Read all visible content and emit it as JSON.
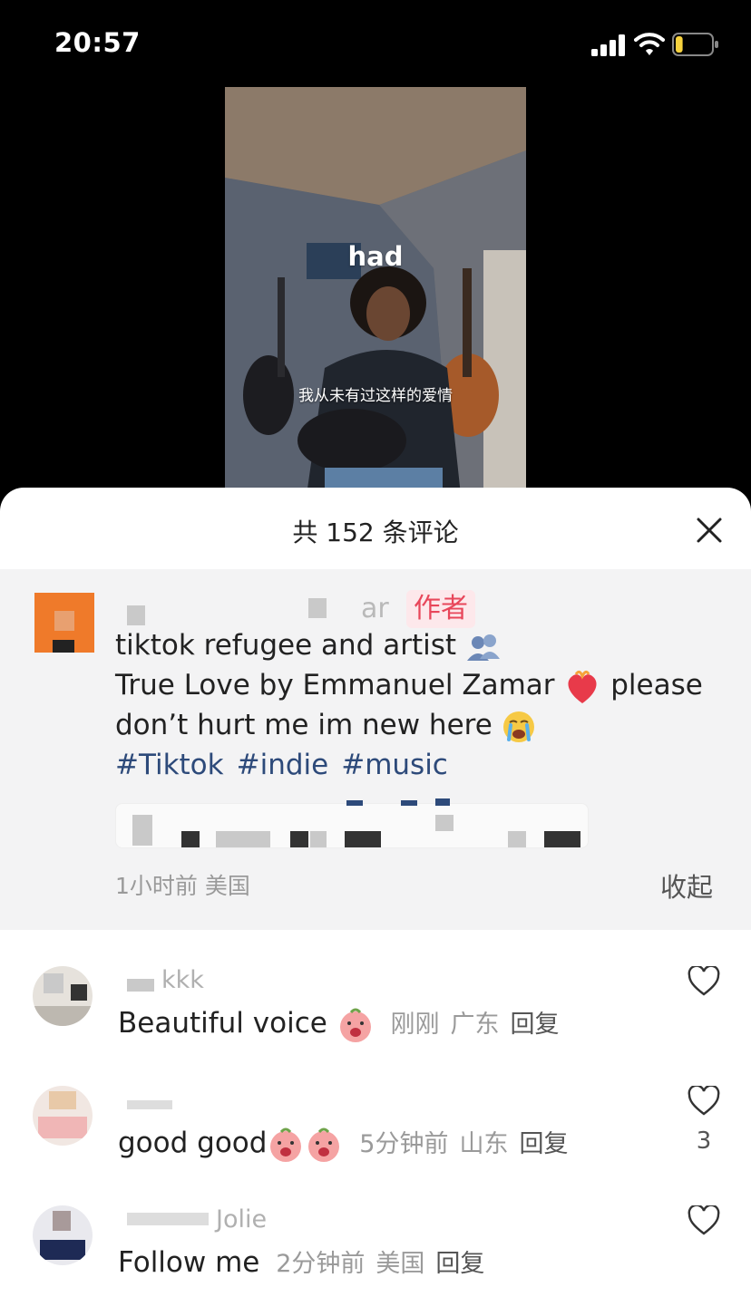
{
  "status_bar": {
    "time": "20:57",
    "battery_level": 0.2
  },
  "video": {
    "lyric_en": "had",
    "lyric_cn": "我从未有过这样的爱情"
  },
  "sheet": {
    "title": "共 152 条评论"
  },
  "author_comment": {
    "name_fragment": "ar",
    "badge": "作者",
    "line1": "tiktok refugee and artist",
    "line2_a": "True Love by Emmanuel Zamar",
    "line2_b": "please",
    "line3": "don’t hurt me im new here",
    "hashtags": [
      "#Tiktok",
      "#indie",
      "#music"
    ],
    "time": "1小时前",
    "region": "美国",
    "collapse": "收起"
  },
  "comments": [
    {
      "name": "kkk",
      "text": "Beautiful voice",
      "time": "刚刚",
      "region": "广东",
      "reply": "回复",
      "likes": ""
    },
    {
      "name": "",
      "text": "good good",
      "time": "5分钟前",
      "region": "山东",
      "reply": "回复",
      "likes": "3"
    },
    {
      "name": "Jolie",
      "text": "Follow me",
      "time": "2分钟前",
      "region": "美国",
      "reply": "回复",
      "likes": ""
    }
  ],
  "colors": {
    "accent": "#e8465a",
    "hashtag": "#2d4a7a",
    "meta": "#9a9a9a"
  }
}
